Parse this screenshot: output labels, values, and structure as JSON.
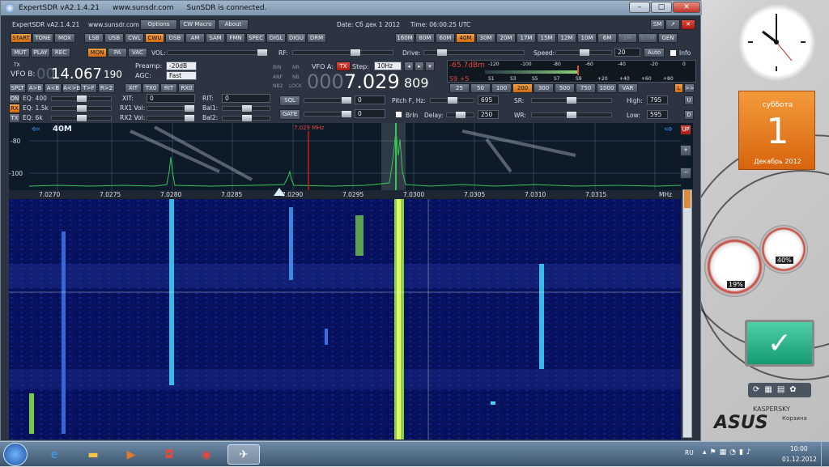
{
  "app": {
    "title": "ExpertSDR vA2.1.4.21",
    "website": "www.sunsdr.com",
    "status": "SunSDR is connected.",
    "menu_title": "ExpertSDR vA2.1.4.21",
    "menu_site": "www.sunsdr.com",
    "options": "Options",
    "cw_macro": "CW Macro",
    "about": "About",
    "date": "Date: Сб дек 1 2012",
    "time": "Time: 06:00:25 UTC"
  },
  "modes_row1": [
    "START",
    "TONE",
    "MOX",
    "LSB",
    "USB",
    "CWL",
    "CWU",
    "DSB",
    "AM",
    "SAM",
    "FMN",
    "SPEC",
    "DIGL",
    "DIGU",
    "DRM"
  ],
  "bands": [
    "160M",
    "80M",
    "60M",
    "40M",
    "30M",
    "20M",
    "17M",
    "15M",
    "12M",
    "10M",
    "6M",
    "2M",
    "0.7M",
    "GEN"
  ],
  "row2": [
    "MUT",
    "PLAY",
    "REC",
    "MON",
    "PA",
    "VAC"
  ],
  "row2_labels": {
    "vol": "VOL:",
    "rf": "RF:",
    "drive": "Drive:",
    "speed": "Speed:",
    "speed_val": "20",
    "auto": "Auto",
    "info": "Info"
  },
  "vfo": {
    "tx": "TX",
    "vfo_b_label": "VFO B:",
    "vfo_b_dim": "00",
    "vfo_b_main": "14.067",
    "vfo_b_small": "190",
    "preamp_label": "Preamp:",
    "preamp_val": "-20dB",
    "agc_label": "AGC:",
    "agc_val": "Fast",
    "bin": "BIN",
    "anf": "ANF",
    "nb2": "NB2",
    "nr": "NR",
    "nb": "NB",
    "lock": "LOCK",
    "vfo_a_label": "VFO A:",
    "tx_badge": "TX",
    "step_label": "Step:",
    "step_val": "10Hz",
    "vfo_a_dim": "000",
    "vfo_a_main": "7.029",
    "vfo_a_small": "809"
  },
  "meter": {
    "reading": "-65.7dBm",
    "s_reading": "S9 +5",
    "top_scale": [
      "-120",
      "-100",
      "-80",
      "-60",
      "-40",
      "-20",
      "0"
    ],
    "bottom_scale": [
      "S1",
      "S3",
      "S5",
      "S7",
      "S9",
      "+20",
      "+40",
      "+60",
      "+80"
    ],
    "bw": [
      "25",
      "50",
      "100",
      "200",
      "300",
      "500",
      "750",
      "1000",
      "VAR"
    ],
    "bw_selected": "200",
    "l_btn": "L",
    "arrow_btn": ">>"
  },
  "vfo_btns": [
    "SPLT",
    "A>B",
    "A<B",
    "A<>B",
    "T>F",
    "R>2"
  ],
  "vfo_btns2": [
    "XIT",
    "TX0",
    "RIT",
    "RX0"
  ],
  "eq": {
    "on": "ON",
    "rx": "RX",
    "tx": "TX",
    "eq1": "EQ: 400",
    "eq2": "EQ: 1.5k",
    "eq3": "EQ: 6k",
    "xit": "XIT:",
    "xit_val": "0",
    "rx1vol": "RX1 Vol:",
    "rx2vol": "RX2 Vol:",
    "rit": "RIT:",
    "rit_val": "0",
    "bal1": "Bal1:",
    "bal2": "Bal2:"
  },
  "sql": {
    "sql": "SQL",
    "gate": "GATE",
    "sql_val": "0",
    "gate_val": "0",
    "pitch": "Pitch F, Hz:",
    "pitch_val": "695",
    "brin": "BrIn",
    "delay": "Delay:",
    "delay_val": "250",
    "sr": "SR:",
    "wr": "WR:",
    "high": "High:",
    "high_val": "795",
    "low": "Low:",
    "low_val": "595",
    "u": "U",
    "d": "D"
  },
  "spectrum": {
    "band": "40M",
    "db1": "-80",
    "db2": "-100",
    "marker": "7.029 MHz",
    "up": "UP",
    "freq_ticks": [
      "7.0270",
      "7.0275",
      "7.0280",
      "7.0285",
      "7.0290",
      "7.0295",
      "7.0300",
      "7.0305",
      "7.0310",
      "7.0315",
      "MHz"
    ]
  },
  "gadgets": {
    "cal_day_name": "суббота",
    "cal_day": "1",
    "cal_month": "Декабрь 2012",
    "cpu": "19%",
    "ram": "40%",
    "kaspersky": "KASPERSKY",
    "kasp_sub": "Корзина",
    "asus": "ASUS"
  },
  "taskbar": {
    "lang": "RU",
    "time": "10:00",
    "date": "01.12.2012"
  },
  "colors": {
    "accent_orange": "#d06a12",
    "spectrum_trace": "#3cc25b",
    "marker_red": "#d01a12",
    "waterfall_bg": "#060a4a"
  }
}
